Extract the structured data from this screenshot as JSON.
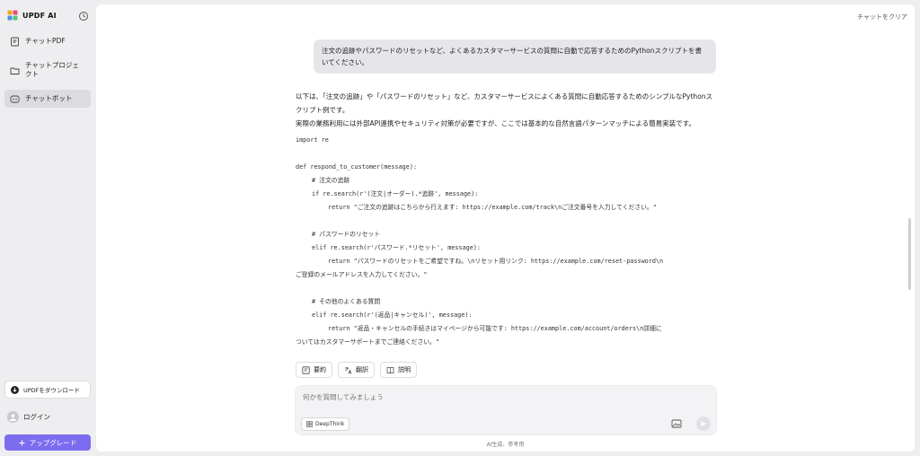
{
  "sidebar": {
    "brand": "UPDF AI",
    "items": [
      {
        "label": "チャットPDF",
        "icon": "pdf-chat-icon"
      },
      {
        "label": "チャットプロジェクト",
        "icon": "folder-icon"
      },
      {
        "label": "チャットボット",
        "icon": "chatbot-icon"
      }
    ],
    "download_label": "UPDFをダウンロード",
    "login_label": "ログイン",
    "upgrade_label": "アップグレード",
    "accent_color": "#7c6cf0"
  },
  "header": {
    "clear_label": "チャットをクリア"
  },
  "chat": {
    "user_message": "注文の追跡やパスワードのリセットなど、よくあるカスタマーサービスの質問に自動で応答するためのPythonスクリプトを書いてください。",
    "answer_paragraphs": [
      "以下は、「注文の追跡」や「パスワードのリセット」など、カスタマーサービスによくある質問に自動応答するためのシンプルなPythonスクリプト例です。",
      "実際の業務利用には外部API連携やセキュリティ対策が必要ですが、ここでは基本的な自然言語パターンマッチによる簡易実装です。"
    ],
    "code_lines": [
      {
        "text": "import re",
        "indent": 0
      },
      {
        "text": "",
        "indent": 0
      },
      {
        "text": "def respond_to_customer(message):",
        "indent": 0
      },
      {
        "text": "# 注文の追跡",
        "indent": 1
      },
      {
        "text": "if re.search(r'(注文|オーダー).*追跡', message):",
        "indent": 1
      },
      {
        "text": "return \"ご注文の追跡はこちらから行えます: https://example.com/track\\nご注文番号を入力してください。\"",
        "indent": 2
      },
      {
        "text": "",
        "indent": 0
      },
      {
        "text": "# パスワードのリセット",
        "indent": 1
      },
      {
        "text": "elif re.search(r'パスワード.*リセット', message):",
        "indent": 1
      },
      {
        "text": "return \"パスワードのリセットをご希望ですね。\\nリセット用リンク: https://example.com/reset-password\\n",
        "indent": 2
      },
      {
        "text": "ご登録のメールアドレスを入力してください。\"",
        "indent": 0
      },
      {
        "text": "",
        "indent": 0
      },
      {
        "text": "# その他のよくある質問",
        "indent": 1
      },
      {
        "text": "elif re.search(r'(返品|キャンセル)', message):",
        "indent": 1
      },
      {
        "text": "return \"返品・キャンセルの手続きはマイページから可能です: https://example.com/account/orders\\n詳細に",
        "indent": 2
      },
      {
        "text": "ついてはカスタマーサポートまでご連絡ください。\"",
        "indent": 0
      }
    ]
  },
  "quick_actions": [
    {
      "label": "要約",
      "icon": "summary-icon"
    },
    {
      "label": "翻訳",
      "icon": "translate-icon"
    },
    {
      "label": "説明",
      "icon": "explain-icon"
    }
  ],
  "composer": {
    "placeholder": "何かを質問してみましょう",
    "deepthink_label": "DeepThink"
  },
  "footer_note": "AI生成、参考用"
}
